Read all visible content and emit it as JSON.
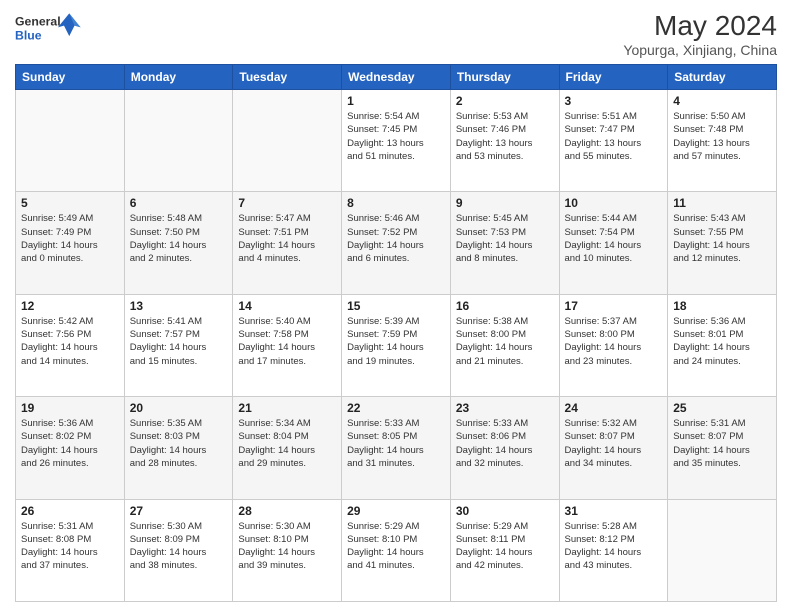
{
  "header": {
    "logo_line1": "General",
    "logo_line2": "Blue",
    "title": "May 2024",
    "subtitle": "Yopurga, Xinjiang, China"
  },
  "weekdays": [
    "Sunday",
    "Monday",
    "Tuesday",
    "Wednesday",
    "Thursday",
    "Friday",
    "Saturday"
  ],
  "weeks": [
    [
      {
        "day": "",
        "info": ""
      },
      {
        "day": "",
        "info": ""
      },
      {
        "day": "",
        "info": ""
      },
      {
        "day": "1",
        "info": "Sunrise: 5:54 AM\nSunset: 7:45 PM\nDaylight: 13 hours\nand 51 minutes."
      },
      {
        "day": "2",
        "info": "Sunrise: 5:53 AM\nSunset: 7:46 PM\nDaylight: 13 hours\nand 53 minutes."
      },
      {
        "day": "3",
        "info": "Sunrise: 5:51 AM\nSunset: 7:47 PM\nDaylight: 13 hours\nand 55 minutes."
      },
      {
        "day": "4",
        "info": "Sunrise: 5:50 AM\nSunset: 7:48 PM\nDaylight: 13 hours\nand 57 minutes."
      }
    ],
    [
      {
        "day": "5",
        "info": "Sunrise: 5:49 AM\nSunset: 7:49 PM\nDaylight: 14 hours\nand 0 minutes."
      },
      {
        "day": "6",
        "info": "Sunrise: 5:48 AM\nSunset: 7:50 PM\nDaylight: 14 hours\nand 2 minutes."
      },
      {
        "day": "7",
        "info": "Sunrise: 5:47 AM\nSunset: 7:51 PM\nDaylight: 14 hours\nand 4 minutes."
      },
      {
        "day": "8",
        "info": "Sunrise: 5:46 AM\nSunset: 7:52 PM\nDaylight: 14 hours\nand 6 minutes."
      },
      {
        "day": "9",
        "info": "Sunrise: 5:45 AM\nSunset: 7:53 PM\nDaylight: 14 hours\nand 8 minutes."
      },
      {
        "day": "10",
        "info": "Sunrise: 5:44 AM\nSunset: 7:54 PM\nDaylight: 14 hours\nand 10 minutes."
      },
      {
        "day": "11",
        "info": "Sunrise: 5:43 AM\nSunset: 7:55 PM\nDaylight: 14 hours\nand 12 minutes."
      }
    ],
    [
      {
        "day": "12",
        "info": "Sunrise: 5:42 AM\nSunset: 7:56 PM\nDaylight: 14 hours\nand 14 minutes."
      },
      {
        "day": "13",
        "info": "Sunrise: 5:41 AM\nSunset: 7:57 PM\nDaylight: 14 hours\nand 15 minutes."
      },
      {
        "day": "14",
        "info": "Sunrise: 5:40 AM\nSunset: 7:58 PM\nDaylight: 14 hours\nand 17 minutes."
      },
      {
        "day": "15",
        "info": "Sunrise: 5:39 AM\nSunset: 7:59 PM\nDaylight: 14 hours\nand 19 minutes."
      },
      {
        "day": "16",
        "info": "Sunrise: 5:38 AM\nSunset: 8:00 PM\nDaylight: 14 hours\nand 21 minutes."
      },
      {
        "day": "17",
        "info": "Sunrise: 5:37 AM\nSunset: 8:00 PM\nDaylight: 14 hours\nand 23 minutes."
      },
      {
        "day": "18",
        "info": "Sunrise: 5:36 AM\nSunset: 8:01 PM\nDaylight: 14 hours\nand 24 minutes."
      }
    ],
    [
      {
        "day": "19",
        "info": "Sunrise: 5:36 AM\nSunset: 8:02 PM\nDaylight: 14 hours\nand 26 minutes."
      },
      {
        "day": "20",
        "info": "Sunrise: 5:35 AM\nSunset: 8:03 PM\nDaylight: 14 hours\nand 28 minutes."
      },
      {
        "day": "21",
        "info": "Sunrise: 5:34 AM\nSunset: 8:04 PM\nDaylight: 14 hours\nand 29 minutes."
      },
      {
        "day": "22",
        "info": "Sunrise: 5:33 AM\nSunset: 8:05 PM\nDaylight: 14 hours\nand 31 minutes."
      },
      {
        "day": "23",
        "info": "Sunrise: 5:33 AM\nSunset: 8:06 PM\nDaylight: 14 hours\nand 32 minutes."
      },
      {
        "day": "24",
        "info": "Sunrise: 5:32 AM\nSunset: 8:07 PM\nDaylight: 14 hours\nand 34 minutes."
      },
      {
        "day": "25",
        "info": "Sunrise: 5:31 AM\nSunset: 8:07 PM\nDaylight: 14 hours\nand 35 minutes."
      }
    ],
    [
      {
        "day": "26",
        "info": "Sunrise: 5:31 AM\nSunset: 8:08 PM\nDaylight: 14 hours\nand 37 minutes."
      },
      {
        "day": "27",
        "info": "Sunrise: 5:30 AM\nSunset: 8:09 PM\nDaylight: 14 hours\nand 38 minutes."
      },
      {
        "day": "28",
        "info": "Sunrise: 5:30 AM\nSunset: 8:10 PM\nDaylight: 14 hours\nand 39 minutes."
      },
      {
        "day": "29",
        "info": "Sunrise: 5:29 AM\nSunset: 8:10 PM\nDaylight: 14 hours\nand 41 minutes."
      },
      {
        "day": "30",
        "info": "Sunrise: 5:29 AM\nSunset: 8:11 PM\nDaylight: 14 hours\nand 42 minutes."
      },
      {
        "day": "31",
        "info": "Sunrise: 5:28 AM\nSunset: 8:12 PM\nDaylight: 14 hours\nand 43 minutes."
      },
      {
        "day": "",
        "info": ""
      }
    ]
  ]
}
